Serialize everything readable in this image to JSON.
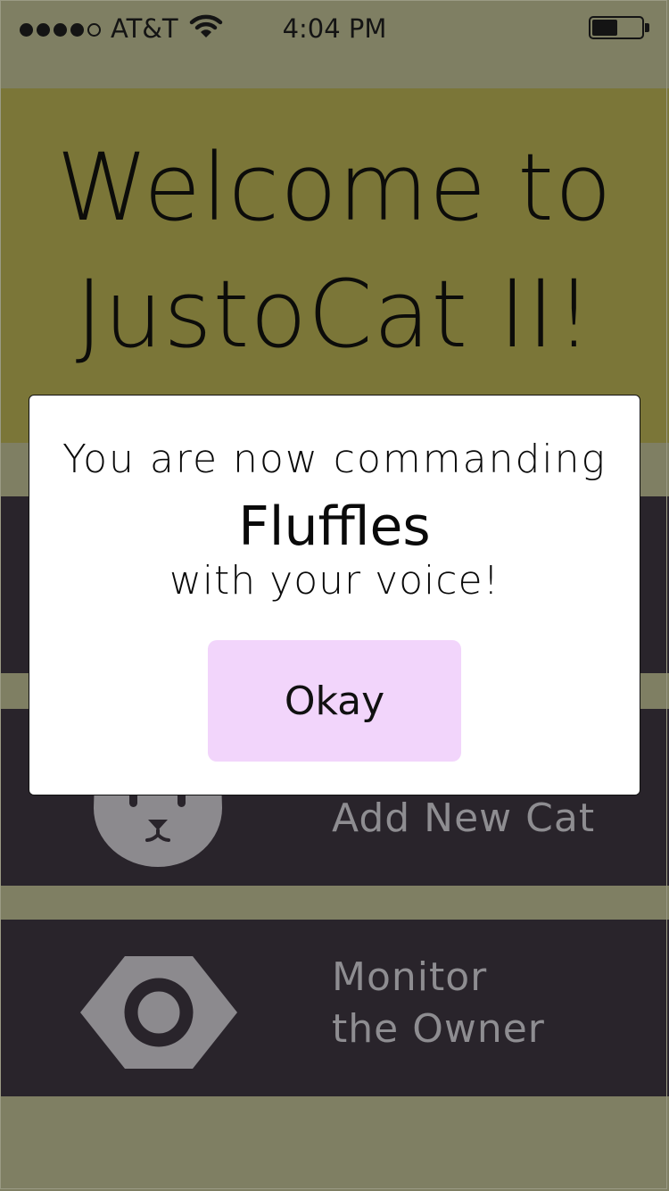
{
  "status_bar": {
    "carrier": "AT&T",
    "time": "4:04 PM",
    "signal_bars_filled": 4,
    "signal_bars_total": 5,
    "wifi_icon": "wifi-icon",
    "battery_level": 0.45
  },
  "header": {
    "title_line1": "Welcome to",
    "title_line2": "JustoCat II!"
  },
  "menu": {
    "items": [
      {
        "label": "Add New Cat",
        "icon": "cat-face-icon"
      },
      {
        "label_line1": "Monitor",
        "label_line2": "the Owner",
        "icon": "eye-icon"
      }
    ]
  },
  "modal": {
    "line1": "You are now commanding",
    "cat_name": "Fluffles",
    "line3": "with your voice!",
    "okay_label": "Okay"
  },
  "colors": {
    "background": "#7f7f63",
    "header": "#7b7638",
    "menu_row": "#29242b",
    "icon_gray": "#8c8a8e",
    "button": "#f2d5fb"
  }
}
